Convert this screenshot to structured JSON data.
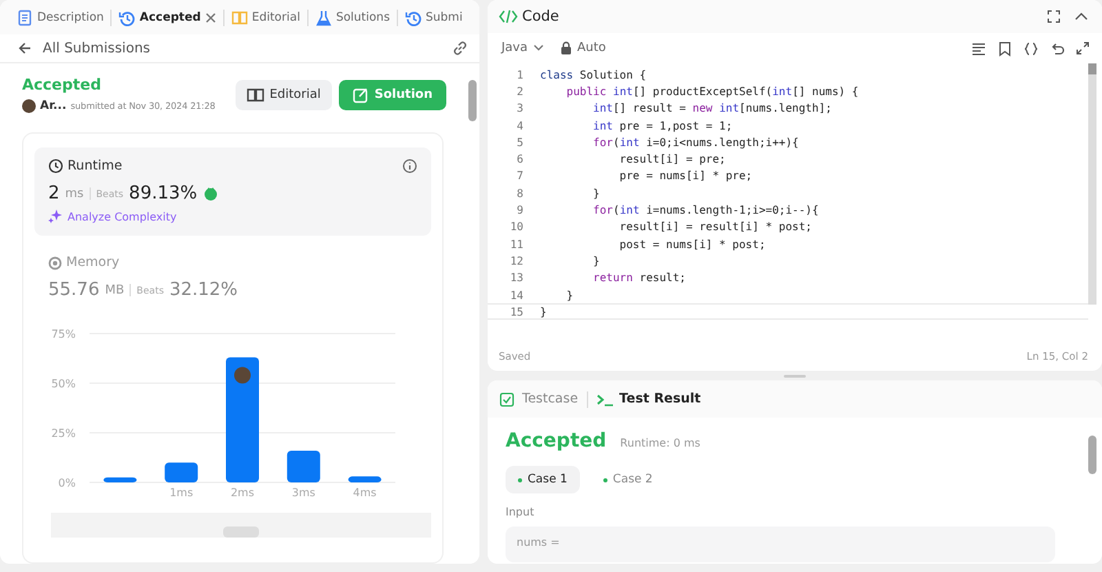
{
  "left_panel": {
    "tabs": [
      {
        "label": "Description",
        "kind": "doc",
        "selected": false,
        "closable": false
      },
      {
        "label": "Accepted",
        "kind": "history",
        "selected": true,
        "closable": true
      },
      {
        "label": "Editorial",
        "kind": "book",
        "selected": false,
        "closable": false
      },
      {
        "label": "Solutions",
        "kind": "flask",
        "selected": false,
        "closable": false
      },
      {
        "label": "Submi",
        "kind": "history",
        "selected": false,
        "closable": false
      }
    ],
    "back_link": "All Submissions",
    "submission": {
      "status": "Accepted",
      "user": "Ar...",
      "submitted": "submitted at Nov 30, 2024 21:28",
      "editorial_button": "Editorial",
      "solution_button": "Solution"
    },
    "runtime": {
      "title": "Runtime",
      "value": "2",
      "unit": "ms",
      "beats_label": "Beats",
      "beats": "89.13%",
      "analyze": "Analyze Complexity"
    },
    "memory": {
      "title": "Memory",
      "value": "55.76",
      "unit": "MB",
      "beats_label": "Beats",
      "beats": "32.12%"
    },
    "chart_data": {
      "type": "bar",
      "categories": [
        null,
        "1ms",
        "2ms",
        "3ms",
        "4ms"
      ],
      "values": [
        2.5,
        10,
        63,
        16,
        3
      ],
      "ylim": [
        0,
        75
      ],
      "yticks": [
        {
          "value": 0,
          "label": "0%"
        },
        {
          "value": 25,
          "label": "25%"
        },
        {
          "value": 50,
          "label": "50%"
        },
        {
          "value": 75,
          "label": "75%"
        }
      ]
    }
  },
  "code_panel": {
    "title": "Code",
    "language": "Java",
    "mode": "Auto",
    "lines": [
      {
        "n": "1",
        "text": "class Solution {",
        "current": false
      },
      {
        "n": "2",
        "text": "    public int[] productExceptSelf(int[] nums) {",
        "current": false
      },
      {
        "n": "3",
        "text": "        int[] result = new int[nums.length];",
        "current": false
      },
      {
        "n": "4",
        "text": "        int pre = 1,post = 1;",
        "current": false
      },
      {
        "n": "5",
        "text": "        for(int i=0;i<nums.length;i++){",
        "current": false
      },
      {
        "n": "6",
        "text": "            result[i] = pre;",
        "current": false
      },
      {
        "n": "7",
        "text": "            pre = nums[i] * pre;",
        "current": false
      },
      {
        "n": "8",
        "text": "        }",
        "current": false
      },
      {
        "n": "9",
        "text": "        for(int i=nums.length-1;i>=0;i--){",
        "current": false
      },
      {
        "n": "10",
        "text": "            result[i] = result[i] * post;",
        "current": false
      },
      {
        "n": "11",
        "text": "            post = nums[i] * post;",
        "current": false
      },
      {
        "n": "12",
        "text": "        }",
        "current": false
      },
      {
        "n": "13",
        "text": "        return result;",
        "current": false
      },
      {
        "n": "14",
        "text": "    }",
        "current": false
      },
      {
        "n": "15",
        "text": "}",
        "current": true
      }
    ],
    "status": "Saved",
    "cursor": "Ln 15, Col 2"
  },
  "result_panel": {
    "tabs": [
      {
        "label": "Testcase",
        "kind": "check",
        "selected": false
      },
      {
        "label": "Test Result",
        "kind": "terminal",
        "selected": true
      }
    ],
    "status": "Accepted",
    "runtime": "Runtime: 0 ms",
    "cases": [
      {
        "label": "Case 1",
        "selected": true
      },
      {
        "label": "Case 2",
        "selected": false
      }
    ],
    "input_label": "Input",
    "input_value": "nums ="
  }
}
